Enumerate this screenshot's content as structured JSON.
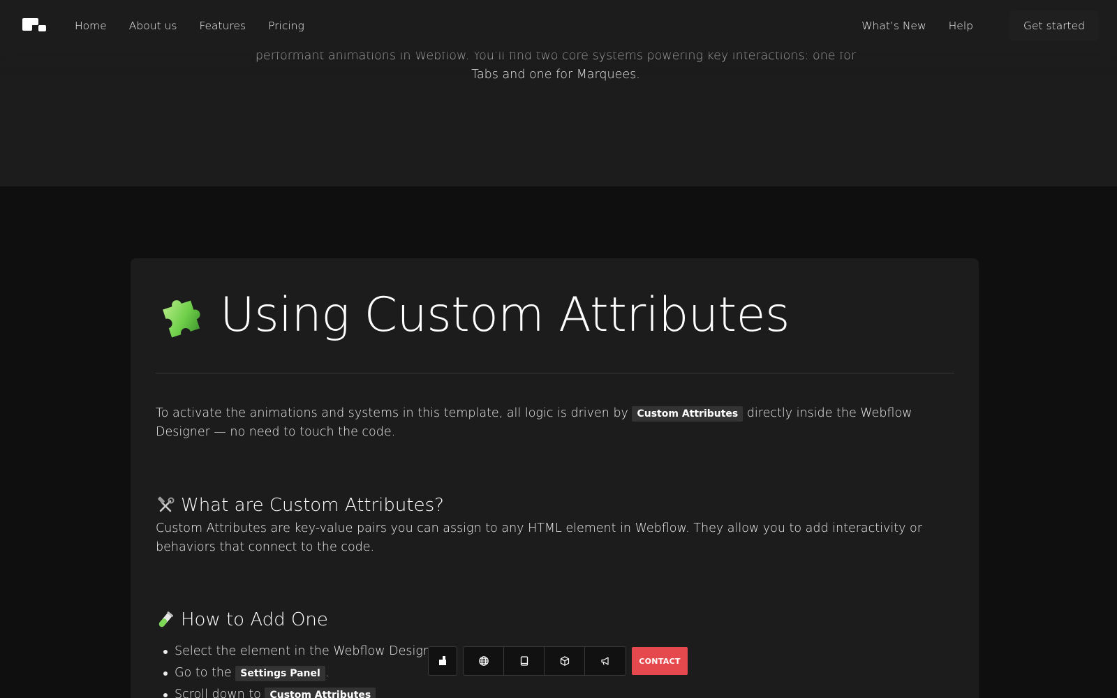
{
  "nav": {
    "links": [
      "Home",
      "About us",
      "Features",
      "Pricing"
    ],
    "right_links": [
      "What’s New",
      "Help"
    ],
    "cta": "Get started"
  },
  "hero": {
    "text": "This template uses custom-built GSAP-powered systems to create smooth, responsive, and performant animations in Webflow. You’ll find two core systems powering key interactions: one for Tabs and one for Marquees."
  },
  "card": {
    "title": "Using Custom Attributes",
    "intro_before": "To activate the animations and systems in this template, all logic is driven by ",
    "intro_code": "Custom Attributes",
    "intro_after": " directly inside the Webflow Designer — no need to touch the code.",
    "section1_title": "What are Custom Attributes?",
    "section1_text": "Custom Attributes are key-value pairs you can assign to any HTML element in Webflow. They allow you to add interactivity or behaviors that connect to the code.",
    "section2_title": "How to Add One",
    "steps": {
      "s1": "Select the element in the Webflow Designer.",
      "s2_before": "Go to the ",
      "s2_code": "Settings Panel",
      "s2_after": ".",
      "s3_before": "Scroll down to ",
      "s3_code": "Custom Attributes"
    }
  },
  "toolbar": {
    "icons": [
      "logo-icon",
      "globe-icon",
      "tablet-icon",
      "cube-icon",
      "megaphone-icon"
    ],
    "contact": "CONTACT"
  },
  "colors": {
    "page_bg": "#0f0f0f",
    "panel_bg": "#1c1c1c",
    "contact_red": "#e5484d"
  }
}
